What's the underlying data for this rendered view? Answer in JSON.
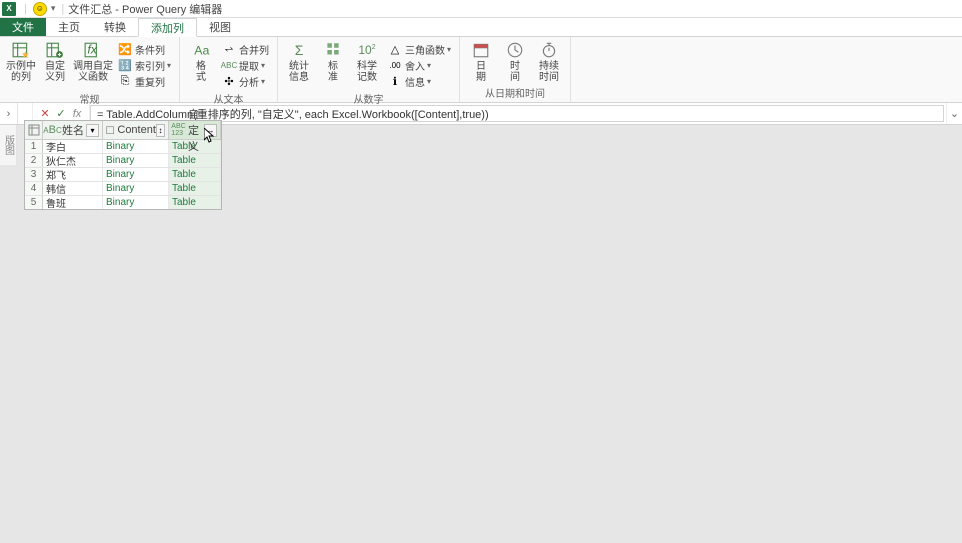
{
  "titlebar": {
    "app_icon": "X",
    "title": "文件汇总 - Power Query 编辑器"
  },
  "tabs": {
    "file": "文件",
    "home": "主页",
    "transform": "转换",
    "addcol": "添加列",
    "view": "视图"
  },
  "ribbon": {
    "g1": {
      "examples": "示例中\n的列",
      "custom": "自定\n义列",
      "invoke": "调用自定\n义函数",
      "cond": "条件列",
      "index": "索引列",
      "dup": "重复列",
      "label": "常规"
    },
    "g2": {
      "format": "格\n式",
      "merge": "合并列",
      "extract": "提取",
      "parse": "分析",
      "label": "从文本"
    },
    "g3": {
      "stats": "统计\n信息",
      "standard": "标\n准",
      "sci": "科学\n记数",
      "trig": "三角函数",
      "round": "舍入",
      "info": "信息",
      "label": "从数字"
    },
    "g4": {
      "date": "日\n期",
      "time": "时\n间",
      "duration": "持续\n时间",
      "label": "从日期和时间"
    }
  },
  "formula": "= Table.AddColumn(重排序的列, \"自定义\", each Excel.Workbook([Content],true))",
  "side_label": "版图",
  "grid": {
    "columns": [
      {
        "name": "姓名",
        "type": "abc"
      },
      {
        "name": "Content",
        "type": "any"
      },
      {
        "name": "自定义",
        "type": "abc123"
      }
    ],
    "rows": [
      {
        "idx": "1",
        "c0": "李白",
        "c1": "Binary",
        "c2": "Table"
      },
      {
        "idx": "2",
        "c0": "狄仁杰",
        "c1": "Binary",
        "c2": "Table"
      },
      {
        "idx": "3",
        "c0": "郑飞",
        "c1": "Binary",
        "c2": "Table"
      },
      {
        "idx": "4",
        "c0": "韩信",
        "c1": "Binary",
        "c2": "Table"
      },
      {
        "idx": "5",
        "c0": "鲁班",
        "c1": "Binary",
        "c2": "Table"
      }
    ]
  }
}
